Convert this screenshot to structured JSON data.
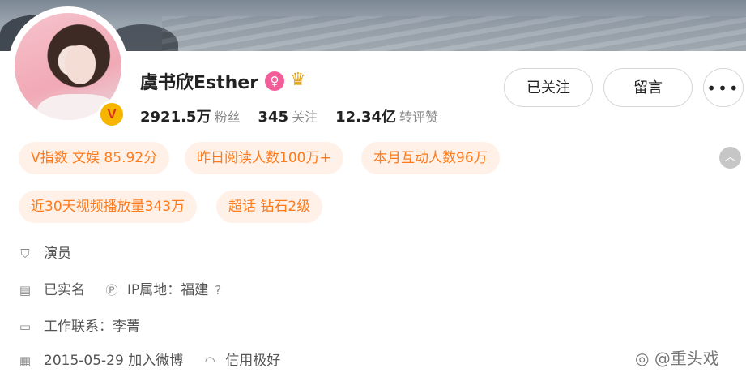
{
  "profile": {
    "name": "虞书欣Esther",
    "verified_badge": "V",
    "gender_icon": "female-icon",
    "crown_icon": "crown-icon"
  },
  "stats": {
    "followers_count": "2921.5万",
    "followers_label": "粉丝",
    "following_count": "345",
    "following_label": "关注",
    "reposts_count": "12.34亿",
    "reposts_label": "转评赞"
  },
  "actions": {
    "followed_label": "已关注",
    "message_label": "留言",
    "more_label": "•••"
  },
  "tags": [
    {
      "label": "V指数 文娱 85.92分"
    },
    {
      "label": "昨日阅读人数100万+"
    },
    {
      "label": "本月互动人数96万"
    },
    {
      "label": "近30天视频播放量343万"
    },
    {
      "label": "超话 钻石2级"
    }
  ],
  "info": {
    "occupation": "演员",
    "realname": "已实名",
    "ip_location": "IP属地：福建",
    "work_contact": "工作联系：李菁",
    "joined": "2015-05-29 加入微博",
    "credit": "信用极好"
  },
  "watermark": "@重头戏",
  "colors": {
    "tag_bg": "#fff1e8",
    "tag_text": "#ff7a1a",
    "gender_badge": "#f25e99",
    "verified_badge": "#f7b500"
  }
}
